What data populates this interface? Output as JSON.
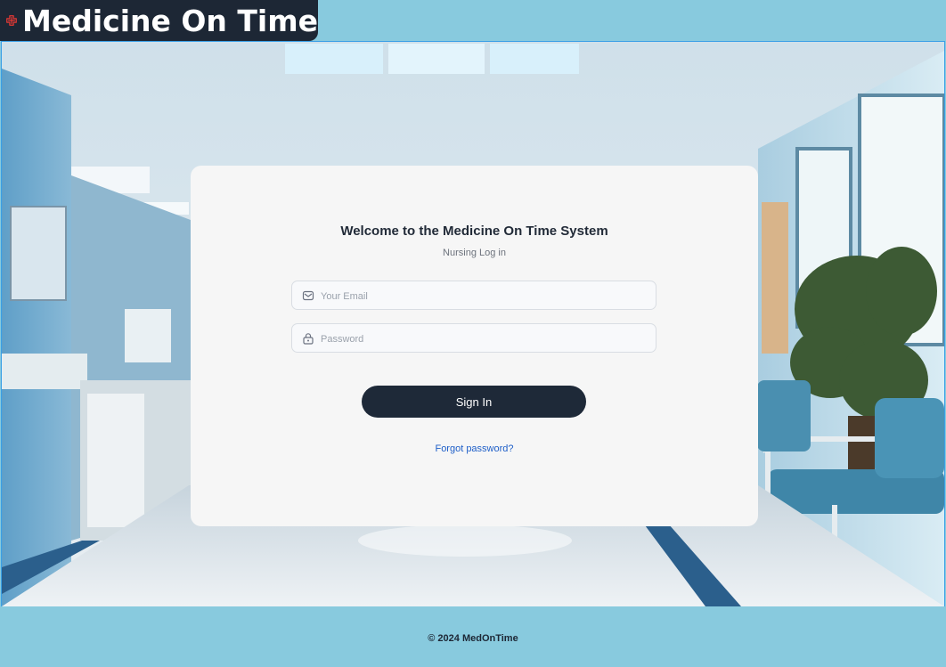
{
  "brand": {
    "name": "Medicine On Time",
    "logo_color": "#e53935",
    "badge_color": "#1d2735"
  },
  "login": {
    "title": "Welcome to the Medicine On Time System",
    "subtitle": "Nursing Log in",
    "email": {
      "placeholder": "Your Email",
      "value": "",
      "icon": "mail-icon"
    },
    "password": {
      "placeholder": "Password",
      "value": "",
      "icon": "lock-icon"
    },
    "submit_label": "Sign In",
    "forgot_label": "Forgot password?"
  },
  "footer": {
    "copyright": "© 2024 MedOnTime"
  },
  "colors": {
    "header_bg": "#88cade",
    "accent_link": "#1f5fc8",
    "button_bg": "#1e2938"
  }
}
